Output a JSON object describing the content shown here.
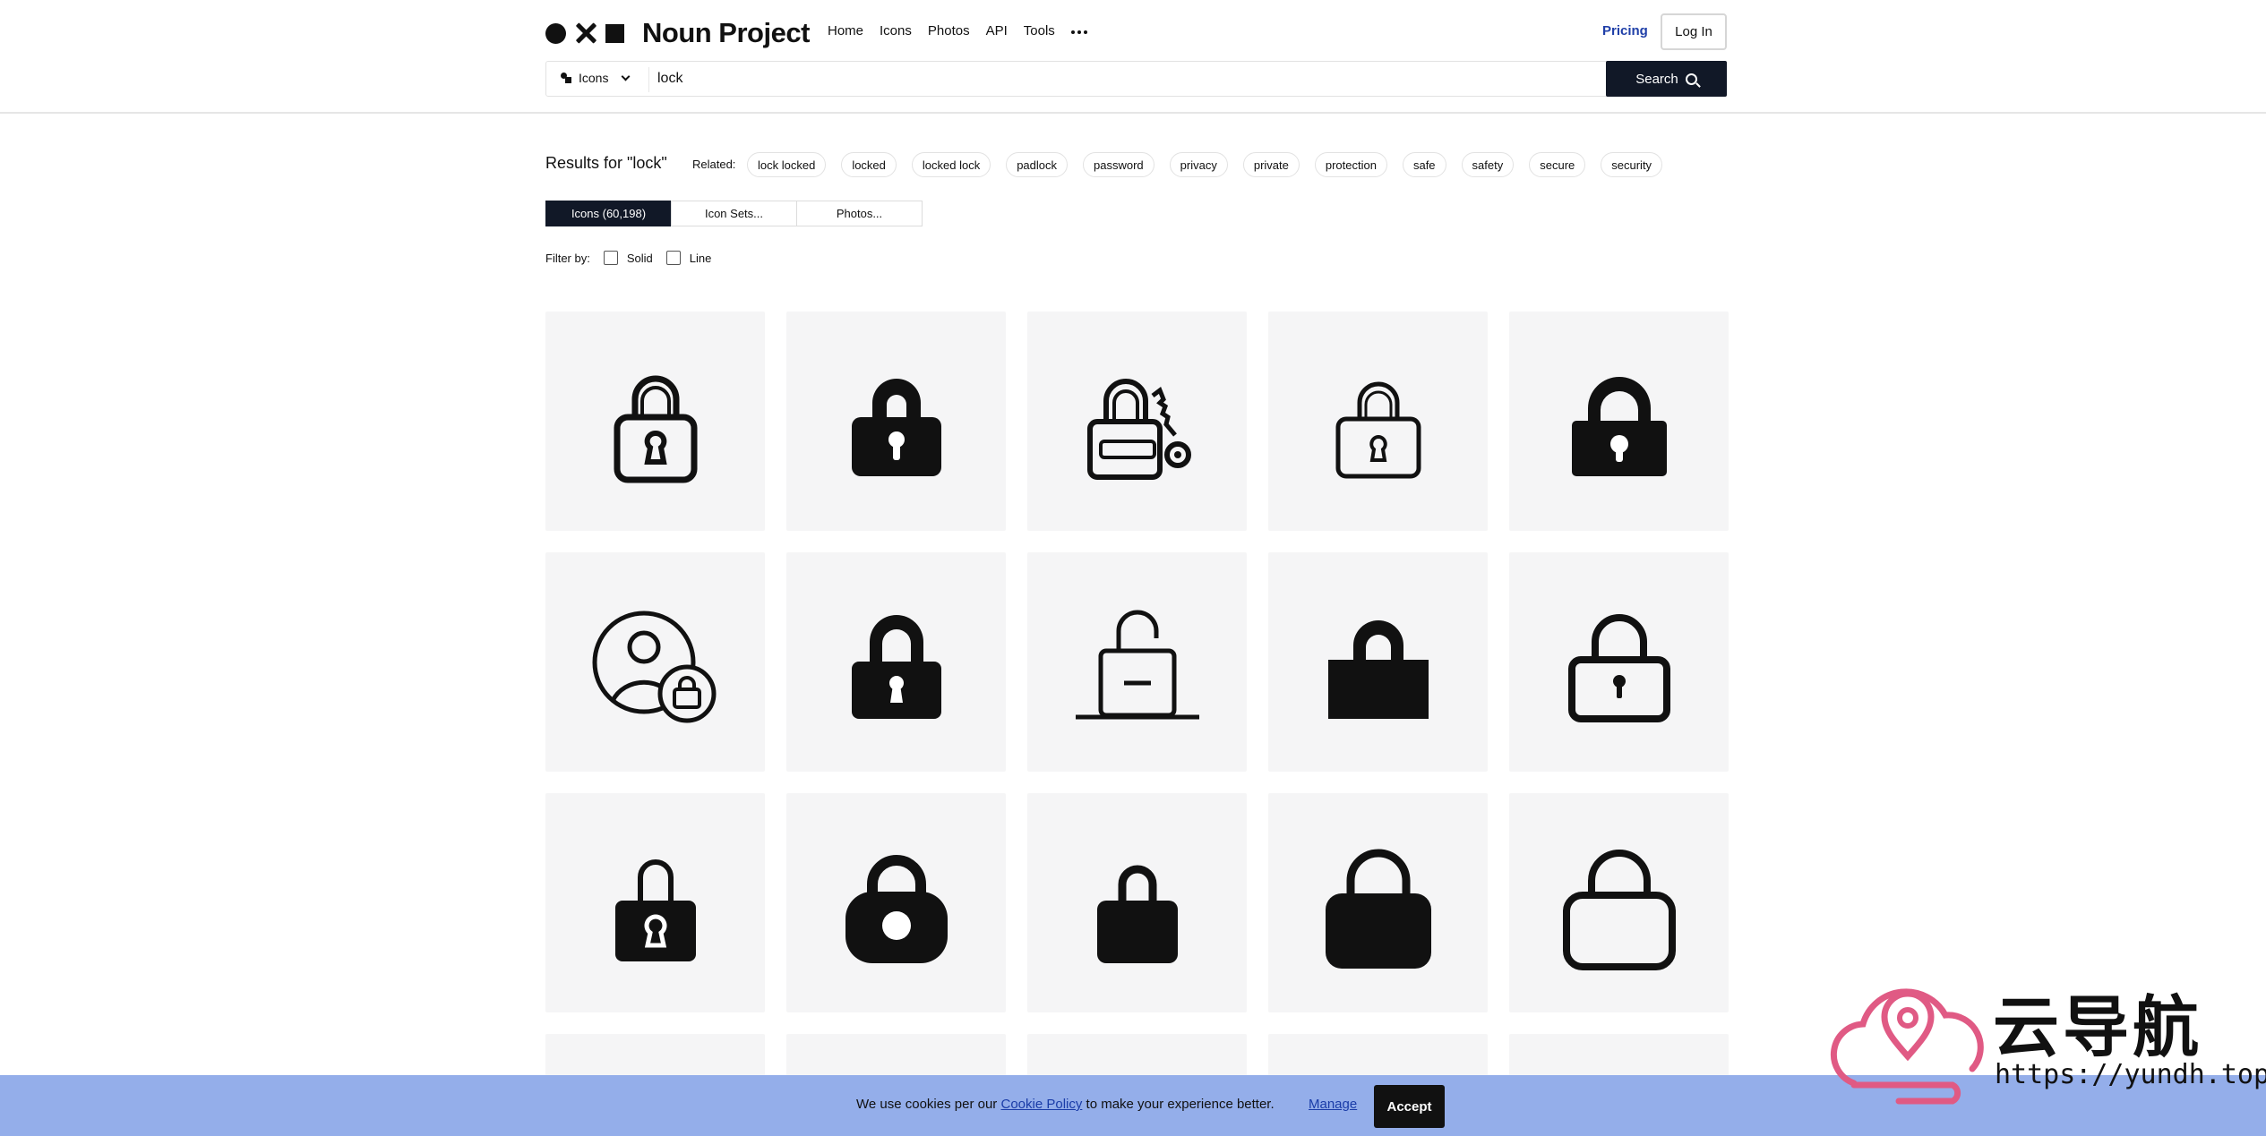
{
  "header": {
    "logo_text": "Noun Project",
    "nav": [
      "Home",
      "Icons",
      "Photos",
      "API",
      "Tools"
    ],
    "pricing": "Pricing",
    "login": "Log In"
  },
  "search": {
    "type_label": "Icons",
    "query": "lock",
    "button": "Search"
  },
  "results": {
    "title": "Results for \"lock\"",
    "related_label": "Related:",
    "related": [
      "lock locked",
      "locked",
      "locked lock",
      "padlock",
      "password",
      "privacy",
      "private",
      "protection",
      "safe",
      "safety",
      "secure",
      "security"
    ],
    "tabs": [
      "Icons (60,198)",
      "Icon Sets...",
      "Photos..."
    ],
    "filter_label": "Filter by:",
    "filters": [
      "Solid",
      "Line"
    ]
  },
  "icons": [
    "padlock-outline-icon",
    "padlock-solid-icon",
    "padlock-key-icon",
    "padlock-outline-small-icon",
    "padlock-solid-wide-icon",
    "user-lock-icon",
    "padlock-solid-keyhole-icon",
    "unlocked-padlock-icon",
    "padlock-silhouette-icon",
    "padlock-outline-keyhole-icon",
    "padlock-rounded-keyhole-icon",
    "padlock-round-body-icon",
    "padlock-simple-solid-icon",
    "padlock-large-solid-icon",
    "padlock-large-outline-icon"
  ],
  "cookie": {
    "text_before": "We use cookies per our ",
    "link": "Cookie Policy",
    "text_after": " to make your experience better.",
    "manage": "Manage",
    "accept": "Accept"
  },
  "watermark": {
    "cn": "云导航",
    "url": "https://yundh.top"
  },
  "colors": {
    "accent_dark": "#111827",
    "pricing_blue": "#1f3fa8",
    "cookie_bg": "#94aeea",
    "tile_bg": "#f5f5f6",
    "watermark_pink": "#e05a84"
  }
}
